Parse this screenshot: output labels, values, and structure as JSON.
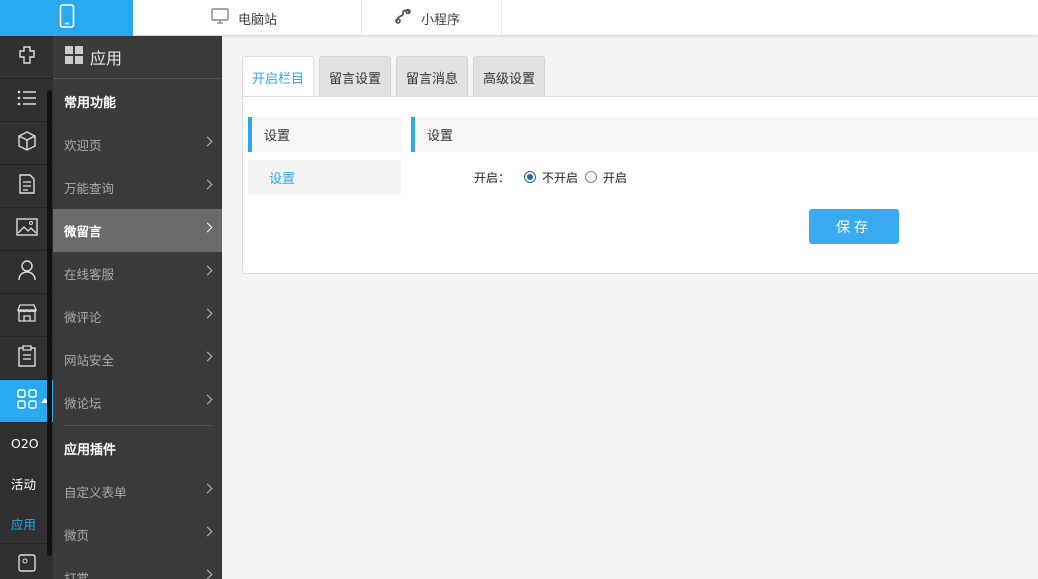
{
  "topbar": {
    "tabs": [
      {
        "label": "电脑站",
        "icon": "monitor-icon"
      },
      {
        "label": "小程序",
        "icon": "mini-program-icon"
      }
    ],
    "active_icon": "mobile-phone-icon"
  },
  "rail": {
    "icons": [
      "plugin-icon",
      "list-icon",
      "cube-icon",
      "document-icon",
      "image-icon",
      "user-icon",
      "store-icon",
      "clipboard-icon",
      "apps-grid-icon"
    ],
    "text_items": [
      "O2O",
      "活动",
      "应用"
    ],
    "current_text_item": "应用"
  },
  "subnav": {
    "title": "应用",
    "group1_title": "常用功能",
    "group1_items": [
      "欢迎页",
      "万能查询",
      "微留言",
      "在线客服",
      "微评论",
      "网站安全",
      "微论坛"
    ],
    "group2_title": "应用插件",
    "group2_items": [
      "自定义表单",
      "微页",
      "打赏"
    ]
  },
  "tabs": [
    "开启栏目",
    "留言设置",
    "留言消息",
    "高级设置"
  ],
  "panel": {
    "left_menu_title": "设置",
    "left_menu_item": "设置",
    "section_title": "设置",
    "field_label": "开启：",
    "options": [
      "不开启",
      "开启"
    ],
    "selected_option": "不开启",
    "save_label": "保存"
  },
  "colors": {
    "accent": "#29a9f0",
    "rail_bg": "#303030",
    "subnav_bg": "#3b3b3b",
    "active_item_bg": "#6a6a6a",
    "save_button": "#3aabf0"
  }
}
